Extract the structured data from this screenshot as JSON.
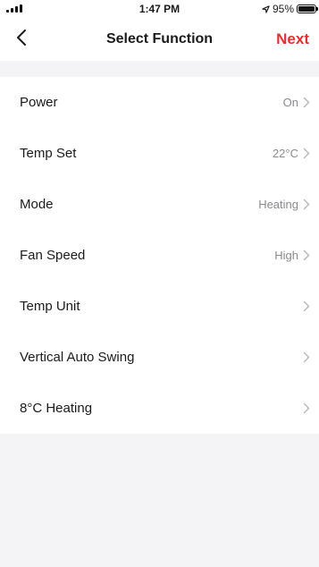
{
  "status_bar": {
    "time": "1:47 PM",
    "battery": "95%",
    "signal_icon": "signal-bars-icon",
    "location_icon": "location-arrow-icon",
    "battery_icon": "battery-icon"
  },
  "nav": {
    "back_icon": "chevron-left-icon",
    "title": "Select Function",
    "next_label": "Next",
    "accent_color": "#e2312f"
  },
  "functions": [
    {
      "label": "Power",
      "value": "On"
    },
    {
      "label": "Temp Set",
      "value": "22°C"
    },
    {
      "label": "Mode",
      "value": "Heating"
    },
    {
      "label": "Fan Speed",
      "value": "High"
    },
    {
      "label": "Temp Unit",
      "value": ""
    },
    {
      "label": "Vertical Auto Swing",
      "value": ""
    },
    {
      "label": "8°C Heating",
      "value": ""
    }
  ]
}
